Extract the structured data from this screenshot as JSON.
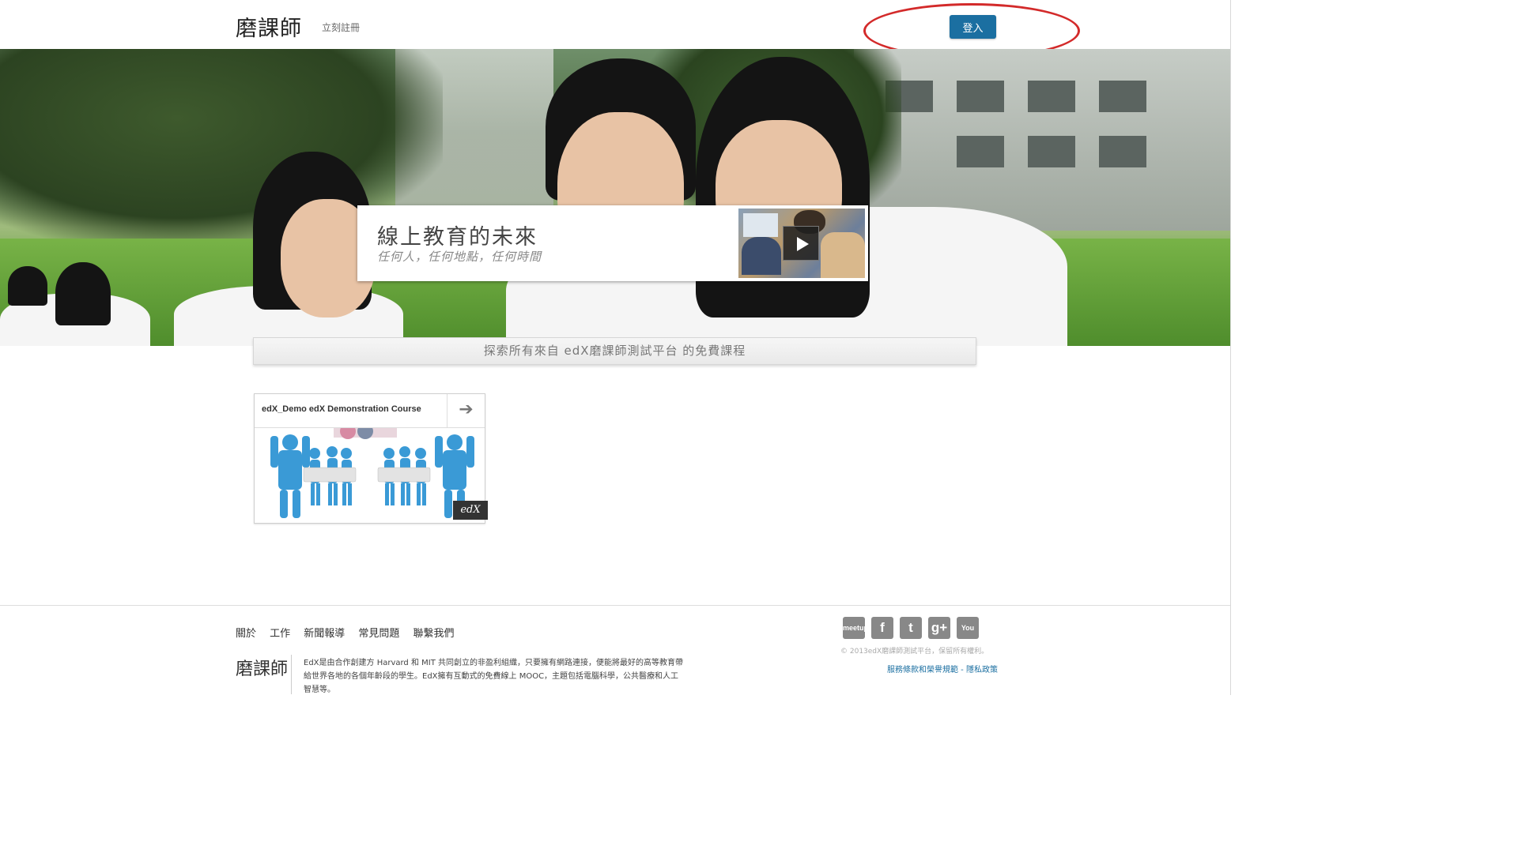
{
  "header": {
    "logo_text": "磨課師",
    "register_label": "立刻註冊",
    "login_label": "登入"
  },
  "hero": {
    "title": "線上教育的未來",
    "subtitle": "任何人，任何地點，任何時間",
    "play_icon": "play-icon"
  },
  "explore": {
    "text": "探索所有來自 edX磨課師測試平台 的免費課程"
  },
  "courses": [
    {
      "title": "edX_Demo edX Demonstration Course",
      "arrow_icon": "arrow-right-icon",
      "tag": "edX"
    }
  ],
  "footer": {
    "nav": [
      "關於",
      "工作",
      "新聞報導",
      "常見問題",
      "聯繫我們"
    ],
    "logo_text": "磨課師",
    "about_text": "EdX是由合作創建方 Harvard 和 MIT 共同創立的非盈利組織，只要擁有網路連接，便能將最好的高等教育帶給世界各地的各個年齡段的學生。EdX擁有互動式的免費線上 MOOC，主題包括電腦科學，公共醫療和人工智慧等。",
    "social": [
      {
        "icon": "meetup-icon",
        "glyph": "meetup"
      },
      {
        "icon": "facebook-icon",
        "glyph": "f"
      },
      {
        "icon": "twitter-icon",
        "glyph": "t"
      },
      {
        "icon": "google-plus-icon",
        "glyph": "g+"
      },
      {
        "icon": "youtube-icon",
        "glyph": "You Tube"
      }
    ],
    "copyright": "© 2013edX磨課師測試平台，保留所有權利。",
    "terms_label": "服務條款和榮譽規範",
    "separator": " - ",
    "privacy_label": "隱私政策"
  },
  "colors": {
    "accent": "#1b6fa1",
    "annotation": "#d32a2a"
  }
}
